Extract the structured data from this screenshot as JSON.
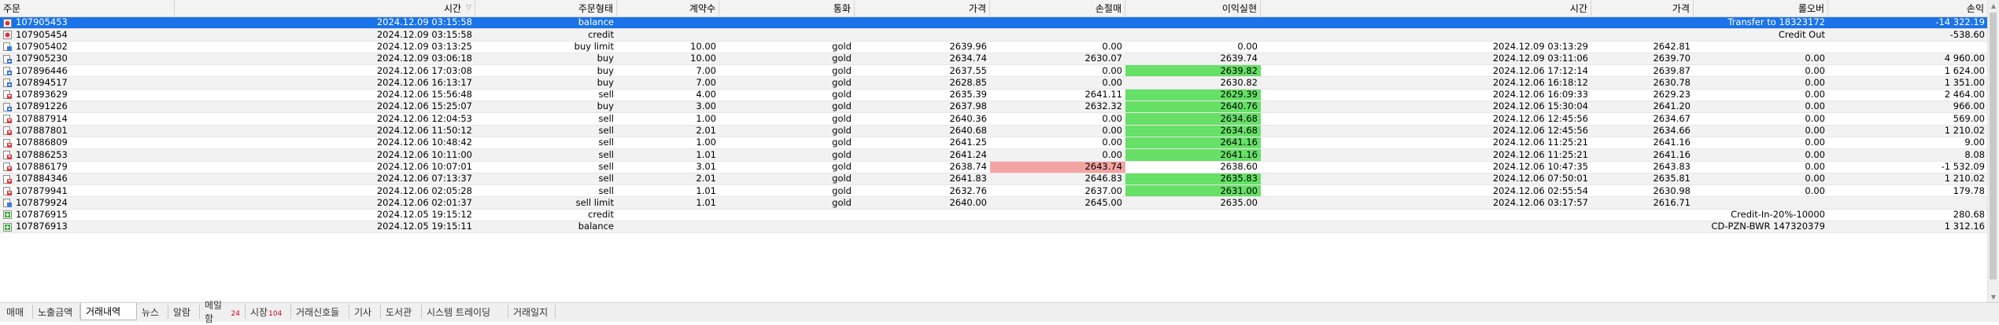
{
  "columns": [
    "주문",
    "시간",
    "주문형태",
    "계약수",
    "통화",
    "가격",
    "손절매",
    "이익실현",
    "시간",
    "가격",
    "롤오버",
    "손익"
  ],
  "rows": [
    {
      "icon": "balance",
      "order": "107905453",
      "time": "2024.12.09 03:15:58",
      "type": "balance",
      "volume": "",
      "symbol": "",
      "price": "",
      "sl": "",
      "tp": "",
      "ctime": "",
      "cprice": "",
      "swap": "Transfer to 18323172",
      "profit": "-14 322.19",
      "sel": true
    },
    {
      "icon": "balance",
      "order": "107905454",
      "time": "2024.12.09 03:15:58",
      "type": "credit",
      "volume": "",
      "symbol": "",
      "price": "",
      "sl": "",
      "tp": "",
      "ctime": "",
      "cprice": "",
      "swap": "Credit Out",
      "profit": "-538.60"
    },
    {
      "icon": "pending",
      "order": "107905402",
      "time": "2024.12.09 03:13:25",
      "type": "buy limit",
      "volume": "10.00",
      "symbol": "gold",
      "price": "2639.96",
      "sl": "0.00",
      "tp": "0.00",
      "ctime": "2024.12.09 03:13:29",
      "cprice": "2642.81",
      "swap": "",
      "profit": ""
    },
    {
      "icon": "buy",
      "order": "107905230",
      "time": "2024.12.09 03:06:18",
      "type": "buy",
      "volume": "10.00",
      "symbol": "gold",
      "price": "2634.74",
      "sl": "2630.07",
      "tp": "2639.74",
      "ctime": "2024.12.09 03:11:06",
      "cprice": "2639.70",
      "swap": "0.00",
      "profit": "4 960.00"
    },
    {
      "icon": "buy",
      "order": "107896446",
      "time": "2024.12.06 17:03:08",
      "type": "buy",
      "volume": "7.00",
      "symbol": "gold",
      "price": "2637.55",
      "sl": "0.00",
      "tp": "2639.82",
      "tpHl": "green",
      "ctime": "2024.12.06 17:12:14",
      "cprice": "2639.87",
      "swap": "0.00",
      "profit": "1 624.00"
    },
    {
      "icon": "buy",
      "order": "107894517",
      "time": "2024.12.06 16:13:17",
      "type": "buy",
      "volume": "7.00",
      "symbol": "gold",
      "price": "2628.85",
      "sl": "0.00",
      "tp": "2630.82",
      "ctime": "2024.12.06 16:18:12",
      "cprice": "2630.78",
      "swap": "0.00",
      "profit": "1 351.00"
    },
    {
      "icon": "sell",
      "order": "107893629",
      "time": "2024.12.06 15:56:48",
      "type": "sell",
      "volume": "4.00",
      "symbol": "gold",
      "price": "2635.39",
      "sl": "2641.11",
      "tp": "2629.39",
      "tpHl": "green",
      "ctime": "2024.12.06 16:09:33",
      "cprice": "2629.23",
      "swap": "0.00",
      "profit": "2 464.00"
    },
    {
      "icon": "buy",
      "order": "107891226",
      "time": "2024.12.06 15:25:07",
      "type": "buy",
      "volume": "3.00",
      "symbol": "gold",
      "price": "2637.98",
      "sl": "2632.32",
      "tp": "2640.76",
      "tpHl": "green",
      "ctime": "2024.12.06 15:30:04",
      "cprice": "2641.20",
      "swap": "0.00",
      "profit": "966.00"
    },
    {
      "icon": "sell",
      "order": "107887914",
      "time": "2024.12.06 12:04:53",
      "type": "sell",
      "volume": "1.00",
      "symbol": "gold",
      "price": "2640.36",
      "sl": "0.00",
      "tp": "2634.68",
      "tpHl": "green",
      "ctime": "2024.12.06 12:45:56",
      "cprice": "2634.67",
      "swap": "0.00",
      "profit": "569.00"
    },
    {
      "icon": "sell",
      "order": "107887801",
      "time": "2024.12.06 11:50:12",
      "type": "sell",
      "volume": "2.01",
      "symbol": "gold",
      "price": "2640.68",
      "sl": "0.00",
      "tp": "2634.68",
      "tpHl": "green",
      "ctime": "2024.12.06 12:45:56",
      "cprice": "2634.66",
      "swap": "0.00",
      "profit": "1 210.02"
    },
    {
      "icon": "sell",
      "order": "107886809",
      "time": "2024.12.06 10:48:42",
      "type": "sell",
      "volume": "1.00",
      "symbol": "gold",
      "price": "2641.25",
      "sl": "0.00",
      "tp": "2641.16",
      "tpHl": "green",
      "ctime": "2024.12.06 11:25:21",
      "cprice": "2641.16",
      "swap": "0.00",
      "profit": "9.00"
    },
    {
      "icon": "sell",
      "order": "107886253",
      "time": "2024.12.06 10:11:00",
      "type": "sell",
      "volume": "1.01",
      "symbol": "gold",
      "price": "2641.24",
      "sl": "0.00",
      "tp": "2641.16",
      "tpHl": "green",
      "ctime": "2024.12.06 11:25:21",
      "cprice": "2641.16",
      "swap": "0.00",
      "profit": "8.08"
    },
    {
      "icon": "sell",
      "order": "107886179",
      "time": "2024.12.06 10:07:01",
      "type": "sell",
      "volume": "3.01",
      "symbol": "gold",
      "price": "2638.74",
      "sl": "2643.74",
      "slHl": "red",
      "tp": "2638.60",
      "ctime": "2024.12.06 10:47:35",
      "cprice": "2643.83",
      "swap": "0.00",
      "profit": "-1 532.09"
    },
    {
      "icon": "sell",
      "order": "107884346",
      "time": "2024.12.06 07:13:37",
      "type": "sell",
      "volume": "2.01",
      "symbol": "gold",
      "price": "2641.83",
      "sl": "2646.83",
      "tp": "2635.83",
      "tpHl": "green",
      "ctime": "2024.12.06 07:50:01",
      "cprice": "2635.81",
      "swap": "0.00",
      "profit": "1 210.02"
    },
    {
      "icon": "sell",
      "order": "107879941",
      "time": "2024.12.06 02:05:28",
      "type": "sell",
      "volume": "1.01",
      "symbol": "gold",
      "price": "2632.76",
      "sl": "2637.00",
      "tp": "2631.00",
      "tpHl": "green",
      "ctime": "2024.12.06 02:55:54",
      "cprice": "2630.98",
      "swap": "0.00",
      "profit": "179.78"
    },
    {
      "icon": "pending",
      "order": "107879924",
      "time": "2024.12.06 02:01:37",
      "type": "sell limit",
      "volume": "1.01",
      "symbol": "gold",
      "price": "2640.00",
      "sl": "2645.00",
      "tp": "2635.00",
      "ctime": "2024.12.06 03:17:57",
      "cprice": "2616.71",
      "swap": "",
      "profit": ""
    },
    {
      "icon": "credit",
      "order": "107876915",
      "time": "2024.12.05 19:15:12",
      "type": "credit",
      "volume": "",
      "symbol": "",
      "price": "",
      "sl": "",
      "tp": "",
      "ctime": "",
      "cprice": "",
      "swap": "Credit-In-20%-10000",
      "profit": "280.68"
    },
    {
      "icon": "credit",
      "order": "107876913",
      "time": "2024.12.05 19:15:11",
      "type": "balance",
      "volume": "",
      "symbol": "",
      "price": "",
      "sl": "",
      "tp": "",
      "ctime": "",
      "cprice": "",
      "swap": "CD-PZN-BWR 147320379",
      "profit": "1 312.16"
    }
  ],
  "tabs": [
    {
      "label": "매매",
      "badge": ""
    },
    {
      "label": "노출금액",
      "badge": ""
    },
    {
      "label": "거래내역",
      "badge": "",
      "active": true
    },
    {
      "label": "뉴스",
      "badge": ""
    },
    {
      "label": "알람",
      "badge": ""
    },
    {
      "label": "메일함",
      "badge": "24"
    },
    {
      "label": "시장",
      "badge": "104"
    },
    {
      "label": "거래신호들",
      "badge": ""
    },
    {
      "label": "기사",
      "badge": ""
    },
    {
      "label": "도서관",
      "badge": ""
    },
    {
      "label": "시스템 트레이딩",
      "badge": ""
    },
    {
      "label": "거래일지",
      "badge": ""
    }
  ],
  "colors": {
    "selection": "#1a73e8",
    "take_profit_hit": "#66e066",
    "stop_loss_hit": "#f4a3a3",
    "badge": "#d0021b"
  },
  "icons": {
    "balance": "balance-icon",
    "credit": "credit-icon",
    "buy": "buy-order-icon",
    "sell": "sell-order-icon",
    "pending": "pending-order-icon"
  }
}
